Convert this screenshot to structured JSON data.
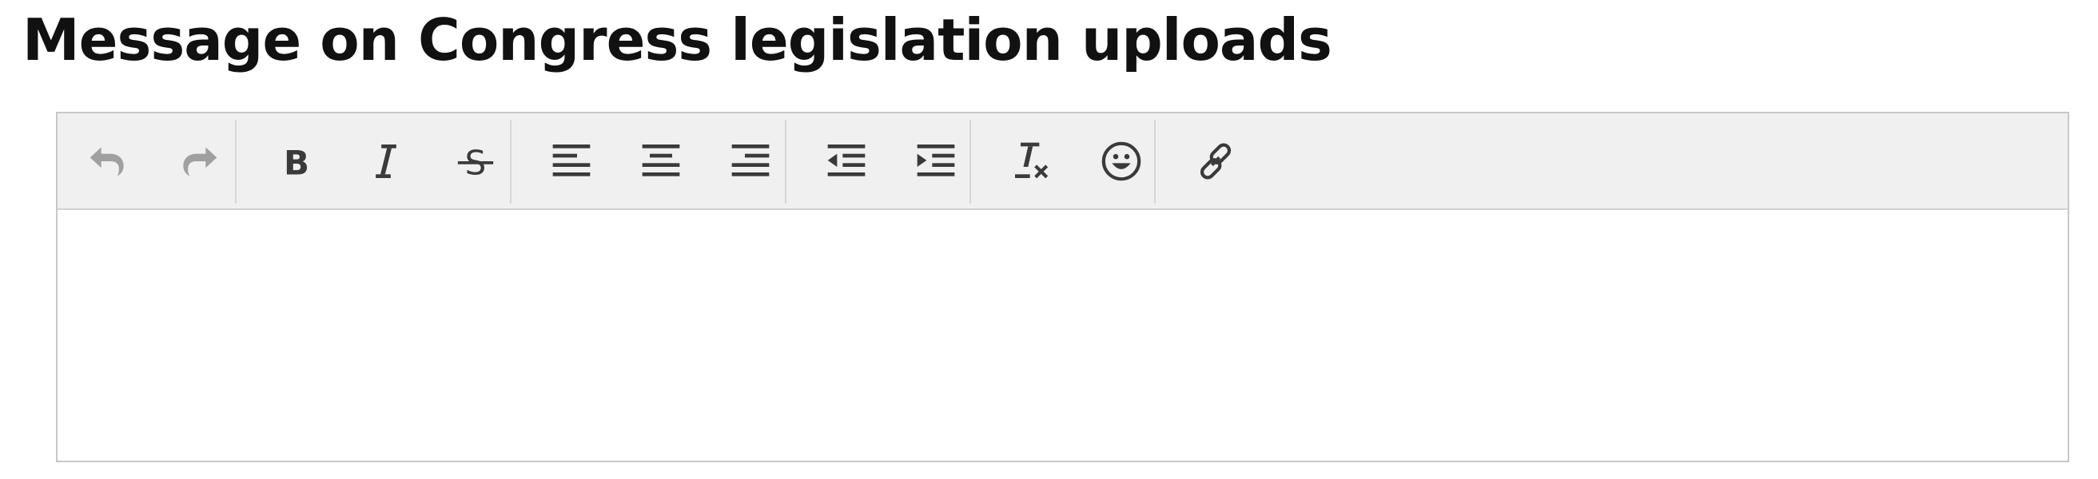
{
  "page": {
    "title": "Message on Congress legislation uploads"
  },
  "editor": {
    "content": "",
    "toolbar": [
      {
        "name": "undo-button",
        "icon": "undo-icon",
        "enabled": false
      },
      {
        "name": "redo-button",
        "icon": "redo-icon",
        "enabled": false
      },
      {
        "name": "bold-button",
        "icon": "bold-icon",
        "enabled": true
      },
      {
        "name": "italic-button",
        "icon": "italic-icon",
        "enabled": true
      },
      {
        "name": "strikethrough-button",
        "icon": "strikethrough-icon",
        "enabled": true
      },
      {
        "name": "align-left-button",
        "icon": "align-left-icon",
        "enabled": true
      },
      {
        "name": "align-center-button",
        "icon": "align-center-icon",
        "enabled": true
      },
      {
        "name": "align-right-button",
        "icon": "align-right-icon",
        "enabled": true
      },
      {
        "name": "outdent-button",
        "icon": "outdent-icon",
        "enabled": true
      },
      {
        "name": "indent-button",
        "icon": "indent-icon",
        "enabled": true
      },
      {
        "name": "clear-formatting-button",
        "icon": "clear-formatting-icon",
        "enabled": true
      },
      {
        "name": "emoticons-button",
        "icon": "emoticon-icon",
        "enabled": true
      },
      {
        "name": "insert-link-button",
        "icon": "link-icon",
        "enabled": true
      }
    ]
  },
  "colors": {
    "icon": "#3a3a3a",
    "icon_disabled": "#a0a0a0",
    "toolbar_bg": "#f0f0f0",
    "border": "#c8c8c8"
  }
}
